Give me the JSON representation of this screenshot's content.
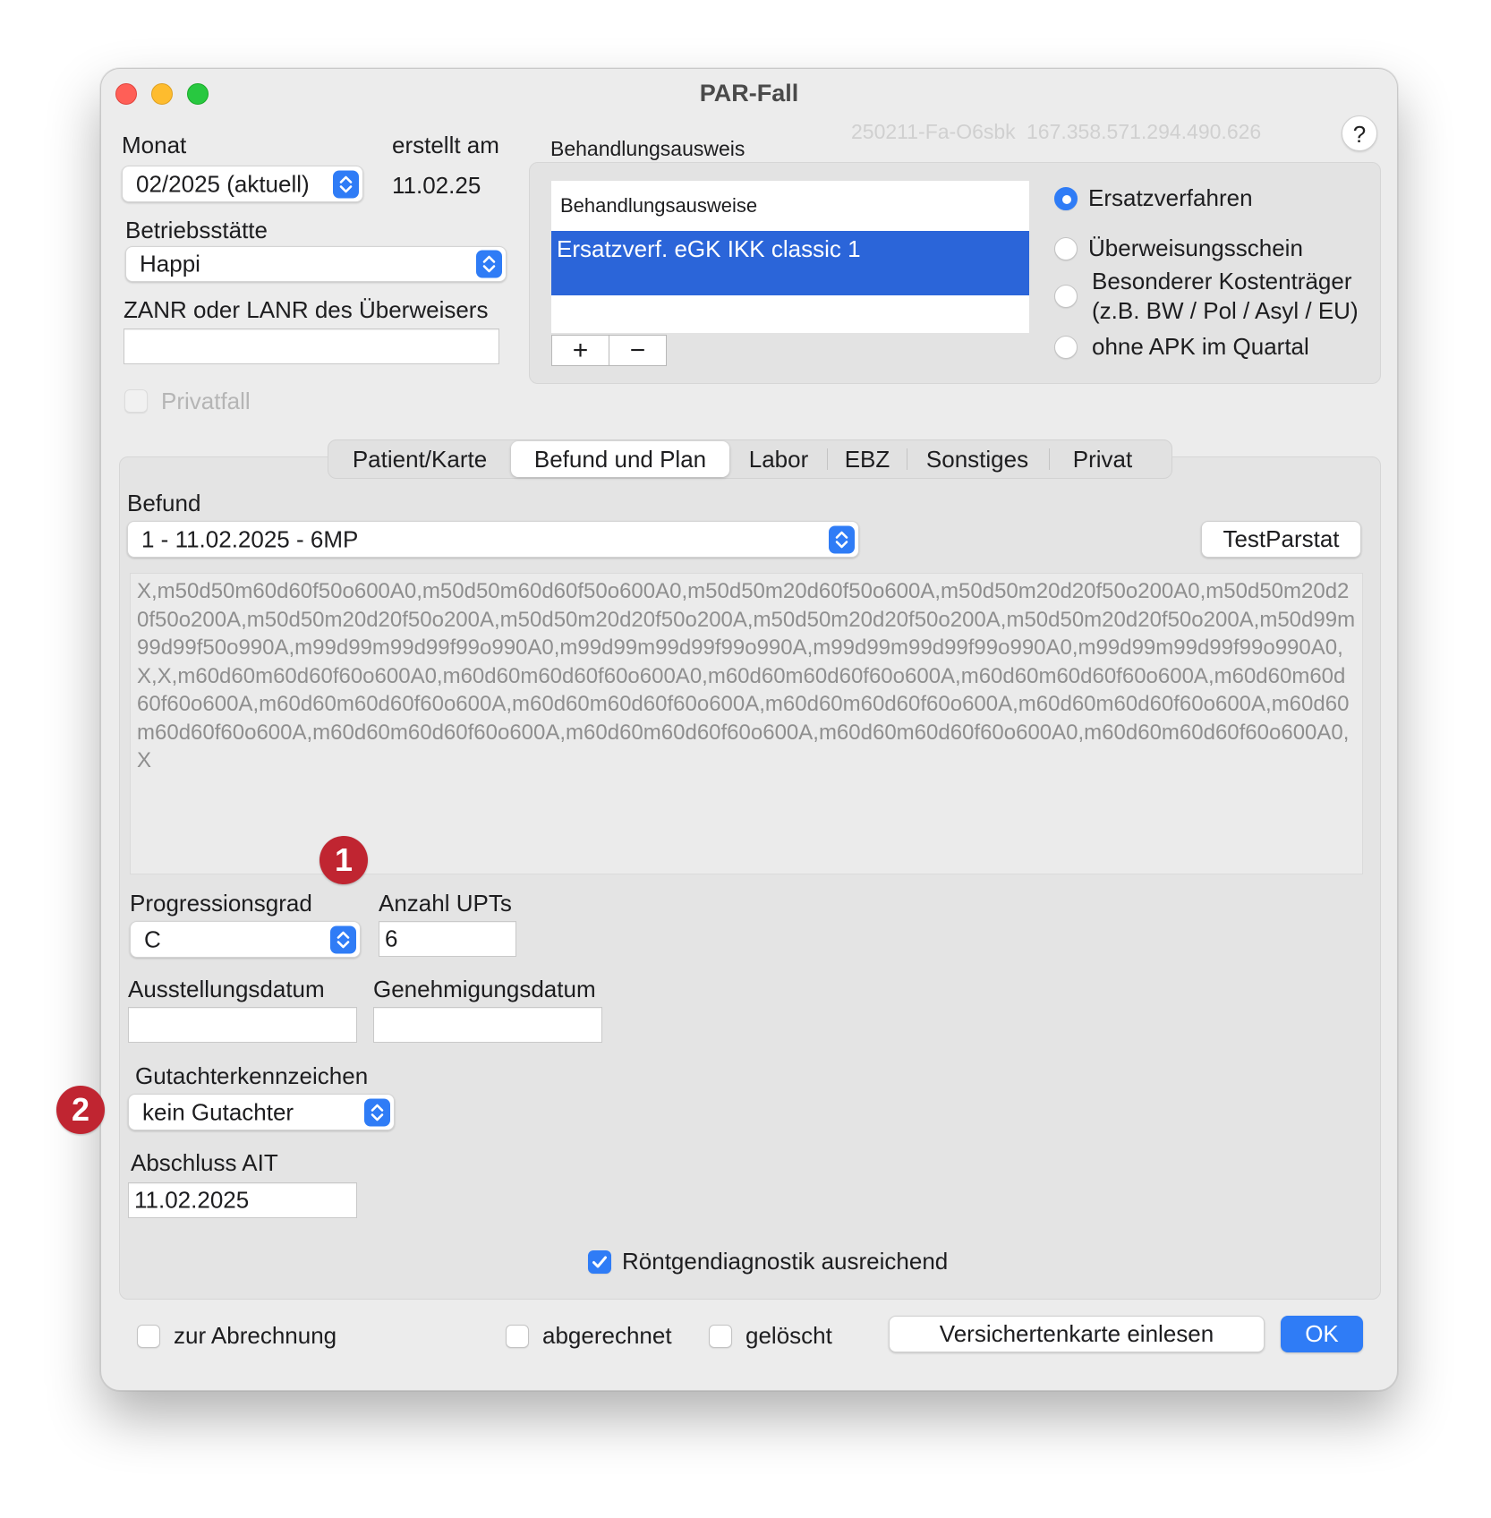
{
  "window": {
    "title": "PAR-Fall",
    "case_id": "250211-Fa-O6sbk",
    "case_number": "167.358.571.294.490.626",
    "help_label": "?"
  },
  "header": {
    "monat_label": "Monat",
    "monat_value": "02/2025 (aktuell)",
    "erstellt_label": "erstellt am",
    "erstellt_value": "11.02.25",
    "betriebsstaette_label": "Betriebsstätte",
    "betriebsstaette_value": "Happi",
    "zanr_label": "ZANR oder LANR des Überweisers",
    "zanr_value": "",
    "privatfall_label": "Privatfall"
  },
  "behandlungsausweis": {
    "group_label": "Behandlungsausweis",
    "list_header": "Behandlungsausweise",
    "items": [
      "Ersatzverf. eGK IKK classic 1"
    ],
    "add_label": "+",
    "remove_label": "−",
    "radio_options": [
      {
        "label": "Ersatzverfahren",
        "selected": true
      },
      {
        "label": "Überweisungsschein",
        "selected": false
      },
      {
        "label": "Besonderer Kostenträger",
        "label2": "(z.B. BW / Pol / Asyl / EU)",
        "selected": false
      },
      {
        "label": "ohne APK im Quartal",
        "selected": false
      }
    ]
  },
  "tabs": [
    {
      "label": "Patient/Karte",
      "active": false
    },
    {
      "label": "Befund und Plan",
      "active": true
    },
    {
      "label": "Labor",
      "active": false
    },
    {
      "label": "EBZ",
      "active": false
    },
    {
      "label": "Sonstiges",
      "active": false
    },
    {
      "label": "Privat",
      "active": false
    }
  ],
  "befund": {
    "label": "Befund",
    "selected": "1 - 11.02.2025 - 6MP",
    "test_button": "TestParstat",
    "code_text": "X,m50d50m60d60f50o600A0,m50d50m60d60f50o600A0,m50d50m20d60f50o600A,m50d50m20d20f50o200A0,m50d50m20d20f50o200A,m50d50m20d20f50o200A,m50d50m20d20f50o200A,m50d50m20d20f50o200A,m50d50m20d20f50o200A,m50d99m99d99f50o990A,m99d99m99d99f99o990A0,m99d99m99d99f99o990A,m99d99m99d99f99o990A0,m99d99m99d99f99o990A0,X,X,m60d60m60d60f60o600A0,m60d60m60d60f60o600A0,m60d60m60d60f60o600A,m60d60m60d60f60o600A,m60d60m60d60f60o600A,m60d60m60d60f60o600A,m60d60m60d60f60o600A,m60d60m60d60f60o600A,m60d60m60d60f60o600A,m60d60m60d60f60o600A,m60d60m60d60f60o600A,m60d60m60d60f60o600A,m60d60m60d60f60o600A0,m60d60m60d60f60o600A0,X"
  },
  "fields": {
    "progressionsgrad_label": "Progressionsgrad",
    "progressionsgrad_value": "C",
    "anzahl_upts_label": "Anzahl UPTs",
    "anzahl_upts_value": "6",
    "ausstellungsdatum_label": "Ausstellungsdatum",
    "ausstellungsdatum_value": "",
    "genehmigungsdatum_label": "Genehmigungsdatum",
    "genehmigungsdatum_value": "",
    "gutachter_label": "Gutachterkennzeichen",
    "gutachter_value": "kein Gutachter",
    "abschluss_label": "Abschluss AIT",
    "abschluss_value": "11.02.2025",
    "roentgen_label": "Röntgendiagnostik ausreichend",
    "roentgen_checked": true
  },
  "footer": {
    "zur_abrechnung_label": "zur Abrechnung",
    "abgerechnet_label": "abgerechnet",
    "geloescht_label": "gelöscht",
    "versichertenkarte_button": "Versichertenkarte einlesen",
    "ok_button": "OK"
  },
  "callouts": {
    "badge1": "1",
    "badge2": "2"
  },
  "colors": {
    "accent": "#2f7cf6",
    "selection": "#2b65d9",
    "badge": "#c02531"
  }
}
